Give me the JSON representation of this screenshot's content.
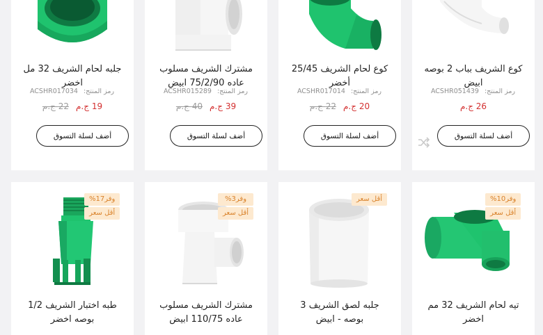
{
  "colors": {
    "pipe_green": "#1fc36e",
    "pipe_white": "#f4f4f4",
    "price_red": "#d32f2f",
    "badge_bg": "#fde9cf",
    "badge_text": "#d9822b"
  },
  "cart_label": "أضف لسلة التسوق",
  "sku_label": "رمز المنتج:",
  "products": [
    {
      "title_line1": "جلبه لحام الشريف 32 مل",
      "title_line2": "اخضر",
      "sku": "ACSHR017034",
      "price": "19 ج.م",
      "old_price": "22 ج.م",
      "image_icon": "green-pipe-coupling-icon"
    },
    {
      "title_line1": "مشترك الشريف مسلوب",
      "title_line2": "عاده 75/2/90 ابيض",
      "sku": "ACSHR015289",
      "price": "39 ج.م",
      "old_price": "40 ج.م",
      "image_icon": "white-pipe-tee-icon"
    },
    {
      "title_line1": "كوع لحام الشريف 25/45",
      "title_line2": "أخضر",
      "sku": "ACSHR017014",
      "price": "20 ج.م",
      "old_price": "22 ج.م",
      "image_icon": "green-pipe-elbow-icon"
    },
    {
      "title_line1": "كوع الشريف بباب 2 بوصه",
      "title_line2": "ابيض",
      "sku": "ACSHR051439",
      "price": "26 ج.م",
      "old_price": "",
      "image_icon": "white-pipe-elbow-icon"
    },
    {
      "title_line1": "طبه اختبار الشريف 1/2",
      "title_line2": "بوصه اخضر",
      "badges": [
        "وفر17%",
        "أقل سعر"
      ],
      "image_icon": "green-test-plug-icon"
    },
    {
      "title_line1": "مشترك الشريف مسلوب",
      "title_line2": "عاده 110/75 ابيض",
      "badges": [
        "وفر3%",
        "أقل سعر"
      ],
      "image_icon": "white-reducing-tee-icon"
    },
    {
      "title_line1": "جلبه لصق الشريف 3",
      "title_line2": "بوصه - ابيض",
      "badges": [
        "أقل سعر"
      ],
      "image_icon": "white-pipe-sleeve-icon"
    },
    {
      "title_line1": "تيه لحام الشريف 32 مم",
      "title_line2": "اخضر",
      "badges": [
        "وفر10%",
        "أقل سعر"
      ],
      "image_icon": "green-pipe-tee-icon"
    }
  ]
}
